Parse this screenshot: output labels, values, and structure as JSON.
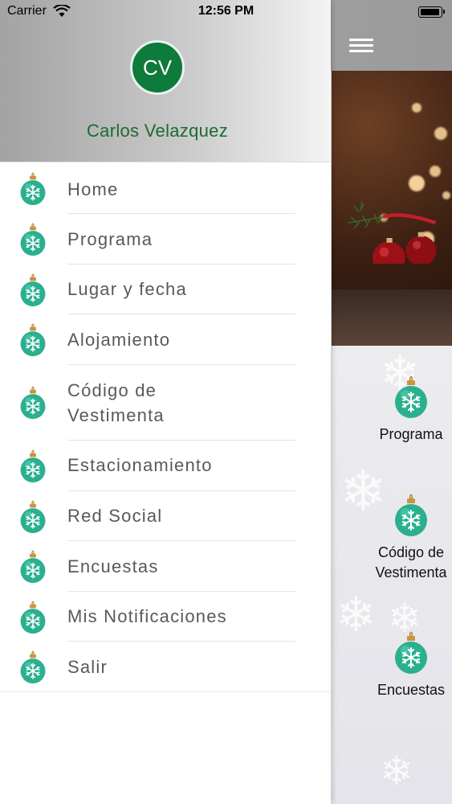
{
  "status_bar": {
    "carrier": "Carrier",
    "time": "12:56 PM"
  },
  "drawer": {
    "avatar_initials": "CV",
    "user_name": "Carlos Velazquez",
    "items": [
      {
        "label": "Home",
        "icon": "ornament-icon"
      },
      {
        "label": "Programa",
        "icon": "ornament-icon"
      },
      {
        "label": "Lugar y fecha",
        "icon": "ornament-icon"
      },
      {
        "label": "Alojamiento",
        "icon": "ornament-icon"
      },
      {
        "label": "Código de\nVestimenta",
        "icon": "ornament-icon"
      },
      {
        "label": "Estacionamiento",
        "icon": "ornament-icon"
      },
      {
        "label": "Red Social",
        "icon": "ornament-icon"
      },
      {
        "label": "Encuestas",
        "icon": "ornament-icon"
      },
      {
        "label": "Mis Notificaciones",
        "icon": "ornament-icon"
      },
      {
        "label": "Salir",
        "icon": "ornament-icon"
      }
    ]
  },
  "main": {
    "menu_icon": "hamburger-icon",
    "grid": [
      {
        "label": "Programa",
        "icon": "ornament-icon"
      },
      {
        "label": "Código de\nVestimenta",
        "icon": "ornament-icon"
      },
      {
        "label": "Encuestas",
        "icon": "ornament-icon"
      }
    ]
  },
  "colors": {
    "accent_green": "#1b6b2f",
    "avatar_bg": "#0e7a3c",
    "ornament_teal": "#2ab08f",
    "header_gray": "#a3a3a3"
  }
}
